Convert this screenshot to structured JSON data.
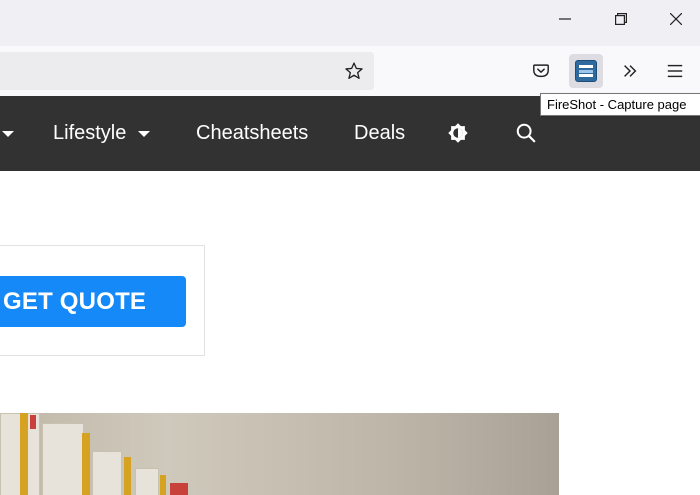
{
  "window": {
    "minimize_icon": "minimize-icon",
    "restore_icon": "restore-icon",
    "close_icon": "close-icon"
  },
  "toolbar": {
    "bookmark_icon": "star-icon",
    "pocket_icon": "pocket-icon",
    "fireshot_icon": "fireshot-icon",
    "overflow_icon": "chevrons-right-icon",
    "menu_icon": "hamburger-menu-icon"
  },
  "tooltip": {
    "text": "FireShot - Capture page"
  },
  "nav": {
    "items": [
      {
        "label": "Lifestyle",
        "has_dropdown": true
      },
      {
        "label": "Cheatsheets",
        "has_dropdown": false
      },
      {
        "label": "Deals",
        "has_dropdown": false
      }
    ],
    "theme_icon": "brightness-icon",
    "search_icon": "search-icon",
    "background": "#323232"
  },
  "ad": {
    "button_label": "GET QUOTE",
    "button_color": "#1489f7"
  }
}
